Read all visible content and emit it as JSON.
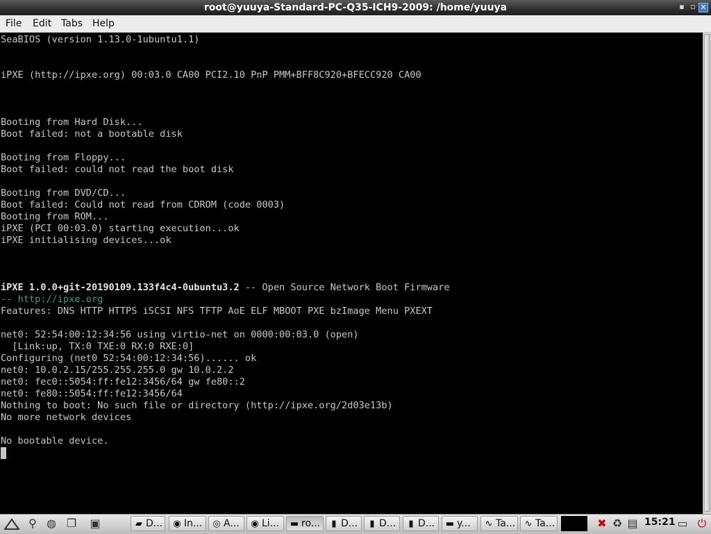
{
  "window": {
    "title": "root@yuuya-Standard-PC-Q35-ICH9-2009: /home/yuuya",
    "controls": {
      "minimize": "▪",
      "maximize": "▫",
      "close": "✕"
    }
  },
  "menu": [
    "File",
    "Edit",
    "Tabs",
    "Help"
  ],
  "terminal": {
    "lines": [
      "SeaBIOS (version 1.13.0-1ubuntu1.1)",
      "iPXE (http://ipxe.org) 00:03.0 CA00 PCI2.10 PnP PMM+BFF8C920+BFECC920 CA00",
      "Booting from Hard Disk...",
      "Boot failed: not a bootable disk",
      "Booting from Floppy...",
      "Boot failed: could not read the boot disk",
      "Booting from DVD/CD...",
      "Boot failed: Could not read from CDROM (code 0003)",
      "Booting from ROM...",
      "iPXE (PCI 00:03.0) starting execution...ok",
      "iPXE initialising devices...ok",
      "iPXE 1.0.0+git-20190109.133f4c4-0ubuntu3.2",
      " -- Open Source Network Boot Firmware",
      "-- ",
      "http://ipxe.org",
      "Features: DNS HTTP HTTPS iSCSI NFS TFTP AoE ELF MBOOT PXE bzImage Menu PXEXT",
      "net0: 52:54:00:12:34:56 using virtio-net on 0000:00:03.0 (open)",
      "  [Link:up, TX:0 TXE:0 RX:0 RXE:0]",
      "Configuring (net0 52:54:00:12:34:56)...... ok",
      "net0: 10.0.2.15/255.255.255.0 gw 10.0.2.2",
      "net0: fec0::5054:ff:fe12:3456/64 gw fe80::2",
      "net0: fe80::5054:ff:fe12:3456/64",
      "Nothing to boot: No such file or directory (http://ipxe.org/2d03e13b)",
      "No more network devices",
      "No bootable device."
    ],
    "colors": {
      "text": "#c8c8c8",
      "link": "#2aa39a",
      "background": "#000000"
    }
  },
  "taskbar": {
    "launchers": [
      "menu-icon",
      "network-icon",
      "windows-icon",
      "desktop-icon"
    ],
    "tasks": [
      {
        "label": "D...",
        "icon": "folder-icon"
      },
      {
        "label": "In...",
        "icon": "firefox-icon"
      },
      {
        "label": "A...",
        "icon": "chromium-icon"
      },
      {
        "label": "Li...",
        "icon": "firefox-icon"
      },
      {
        "label": "ro...",
        "icon": "terminal-icon"
      },
      {
        "label": "D...",
        "icon": "document-icon"
      },
      {
        "label": "D...",
        "icon": "document-icon"
      },
      {
        "label": "D...",
        "icon": "document-icon"
      },
      {
        "label": "y...",
        "icon": "terminal-icon"
      },
      {
        "label": "Ta...",
        "icon": "monitor-icon"
      },
      {
        "label": "Ta...",
        "icon": "monitor-icon"
      }
    ],
    "clock": "15:21"
  }
}
